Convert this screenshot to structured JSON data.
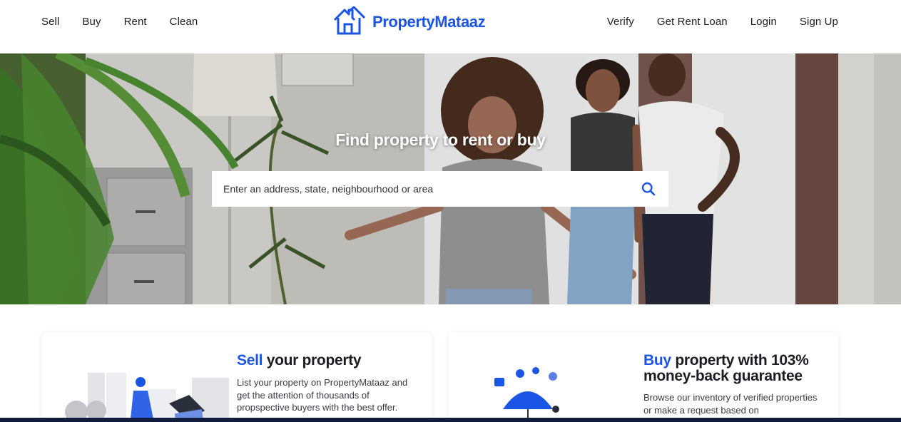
{
  "nav": {
    "left": [
      "Sell",
      "Buy",
      "Rent",
      "Clean"
    ],
    "right": [
      "Verify",
      "Get Rent Loan",
      "Login",
      "Sign Up"
    ]
  },
  "logo": {
    "text": "PropertyMataaz",
    "icon": "house-outline-icon"
  },
  "hero": {
    "title": "Find property to rent or buy",
    "search_placeholder": "Enter an address, state, neighbourhood or area",
    "search_icon": "search-icon"
  },
  "cards": {
    "sell": {
      "title_accent": "Sell",
      "title_rest": " your property",
      "desc": "List your property on PropertyMataaz and get the attention of thousands of propspective buyers with the best offer."
    },
    "buy": {
      "title_accent": "Buy",
      "title_rest": " property with 103% money-back guarantee",
      "desc": "Browse our inventory of verified properties or make a request based on"
    }
  },
  "colors": {
    "brand": "#1a55e6",
    "text": "#1c1c24"
  }
}
